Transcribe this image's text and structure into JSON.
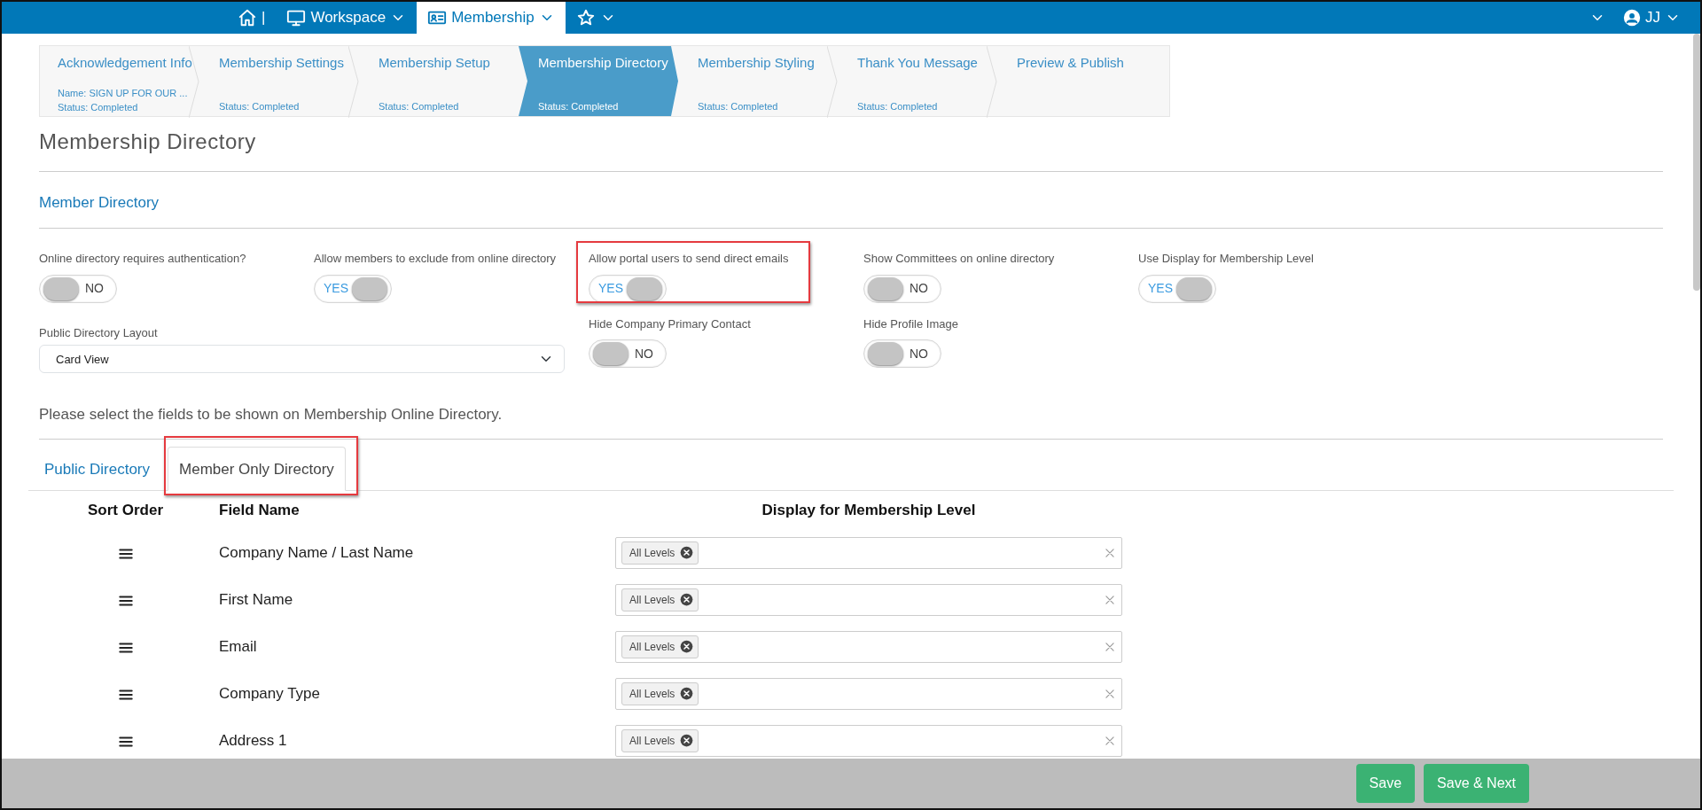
{
  "topbar": {
    "items": [
      {
        "kind": "home",
        "label": "|",
        "selected": false
      },
      {
        "kind": "workspace",
        "label": "Workspace",
        "selected": false
      },
      {
        "kind": "membership",
        "label": "Membership",
        "selected": true
      },
      {
        "kind": "favorites",
        "selected": false
      }
    ],
    "user": {
      "initials": "JJ"
    }
  },
  "wizard": [
    {
      "title": "Acknowledgement Info",
      "detail": "Name: SIGN UP FOR OUR ...",
      "status": "Status: Completed",
      "selected": false
    },
    {
      "title": "Membership Settings",
      "status": "Status: Completed",
      "selected": false
    },
    {
      "title": "Membership Setup",
      "status": "Status: Completed",
      "selected": false
    },
    {
      "title": "Membership Directory",
      "status": "Status: Completed",
      "selected": true
    },
    {
      "title": "Membership Styling",
      "status": "Status: Completed",
      "selected": false
    },
    {
      "title": "Thank You Message",
      "status": "Status: Completed",
      "selected": false
    },
    {
      "title": "Preview & Publish",
      "selected": false
    }
  ],
  "page_title": "Membership Directory",
  "section_title": "Member Directory",
  "toggles_row_1": [
    {
      "label": "Online directory requires authentication?",
      "on": false,
      "state_text": "NO",
      "highlighted": false
    },
    {
      "label": "Allow members to exclude from online directory",
      "on": true,
      "state_text": "YES",
      "highlighted": false
    },
    {
      "label": "Allow portal users to send direct emails",
      "on": true,
      "state_text": "YES",
      "highlighted": true
    },
    {
      "label": "Show Committees on online directory",
      "on": false,
      "state_text": "NO",
      "highlighted": false
    },
    {
      "label": "Use Display for Membership Level",
      "on": true,
      "state_text": "YES",
      "highlighted": false
    }
  ],
  "layout_select": {
    "label": "Public Directory Layout",
    "value": "Card View"
  },
  "toggles_row_2": [
    {
      "label": "Hide Company Primary Contact",
      "on": false,
      "state_text": "NO",
      "highlighted": false
    },
    {
      "label": "Hide Profile Image",
      "on": false,
      "state_text": "NO",
      "highlighted": false
    }
  ],
  "instructions": "Please select the fields to be shown on Membership Online Directory.",
  "tabs": [
    {
      "label": "Public Directory",
      "selected": false,
      "highlighted": false
    },
    {
      "label": "Member Only Directory",
      "selected": true,
      "highlighted": true
    }
  ],
  "table": {
    "columns": [
      "Sort Order",
      "Field Name",
      "Display for Membership Level"
    ],
    "rows": [
      {
        "field": "Company Name / Last Name",
        "tags": [
          "All Levels"
        ]
      },
      {
        "field": "First Name",
        "tags": [
          "All Levels"
        ]
      },
      {
        "field": "Email",
        "tags": [
          "All Levels"
        ]
      },
      {
        "field": "Company Type",
        "tags": [
          "All Levels"
        ]
      },
      {
        "field": "Address 1",
        "tags": [
          "All Levels"
        ]
      }
    ]
  },
  "footer_buttons": [
    "Save",
    "Save & Next"
  ]
}
